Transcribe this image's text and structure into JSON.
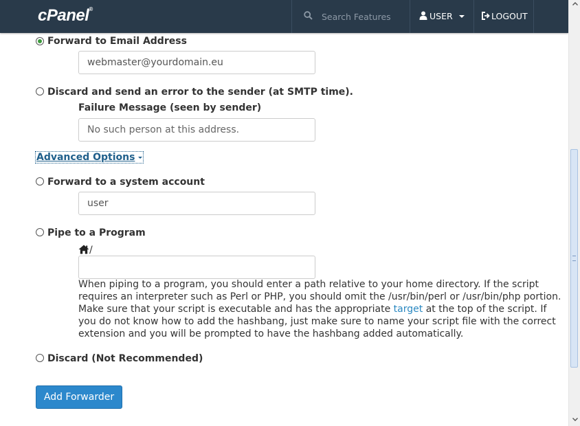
{
  "header": {
    "logo_text": "cPanel",
    "logo_mark": "®",
    "search_placeholder": "Search Features",
    "user_label": "USER",
    "logout_label": "LOGOUT"
  },
  "options": {
    "forward_email": {
      "label": "Forward to Email Address",
      "value": "webmaster@yourdomain.eu",
      "selected": true
    },
    "discard_error": {
      "label": "Discard and send an error to the sender (at SMTP time).",
      "failure_label": "Failure Message (seen by sender)",
      "failure_value": "No such person at this address.",
      "selected": false
    },
    "advanced_link": "Advanced Options",
    "system_account": {
      "label": "Forward to a system account",
      "value": "user",
      "selected": false
    },
    "pipe": {
      "label": "Pipe to a Program",
      "home_suffix": "/",
      "value": "",
      "help_1": "When piping to a program, you should enter a path relative to your home directory. If the script requires an interpreter such as Perl or PHP, you should omit the /usr/bin/perl or /usr/bin/php portion. Make sure that your script is executable and has the appropriate ",
      "help_link": "target",
      "help_2": " at the top of the script. If you do not know how to add the hashbang, just make sure to name your script file with the correct extension and you will be prompted to have the hashbang added automatically.",
      "selected": false
    },
    "discard": {
      "label": "Discard (Not Recommended)",
      "selected": false
    }
  },
  "submit_label": "Add Forwarder",
  "colors": {
    "topbar": "#293a4a",
    "primary_button": "#2c88cc",
    "link": "#2a88c1",
    "selected_radio": "#3c9a3c"
  },
  "icons": [
    "search-icon",
    "user-icon",
    "logout-icon",
    "home-icon",
    "chevron-down-icon"
  ]
}
